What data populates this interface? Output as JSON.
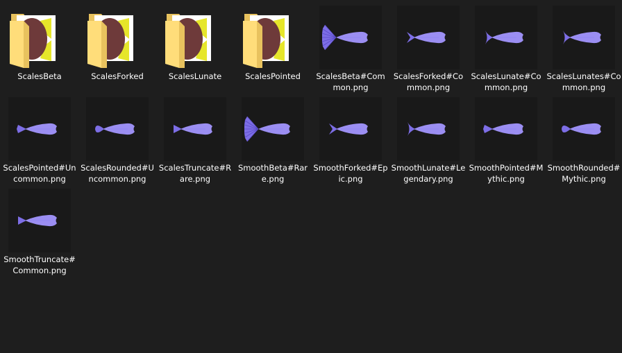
{
  "items": [
    {
      "name": "ScalesBeta",
      "kind": "folder",
      "icon": "folder-icon",
      "preview": "ScalesBeta"
    },
    {
      "name": "ScalesForked",
      "kind": "folder",
      "icon": "folder-icon",
      "preview": "ScalesForked"
    },
    {
      "name": "ScalesLunate",
      "kind": "folder",
      "icon": "folder-icon",
      "preview": "ScalesLunate"
    },
    {
      "name": "ScalesPointed",
      "kind": "folder",
      "icon": "folder-icon",
      "preview": "ScalesPointed"
    },
    {
      "name": "ScalesBeta#Common.png",
      "kind": "image",
      "icon": "fish-thumbnail",
      "tail": "beta"
    },
    {
      "name": "ScalesForked#Common.png",
      "kind": "image",
      "icon": "fish-thumbnail",
      "tail": "forked"
    },
    {
      "name": "ScalesLunate#Common.png",
      "kind": "image",
      "icon": "fish-thumbnail",
      "tail": "lunate"
    },
    {
      "name": "ScalesLunates#Common.png",
      "kind": "image",
      "icon": "fish-thumbnail",
      "tail": "lunate"
    },
    {
      "name": "ScalesPointed#Uncommon.png",
      "kind": "image",
      "icon": "fish-thumbnail",
      "tail": "pointed"
    },
    {
      "name": "ScalesRounded#Uncommon.png",
      "kind": "image",
      "icon": "fish-thumbnail",
      "tail": "rounded"
    },
    {
      "name": "ScalesTruncate#Rare.png",
      "kind": "image",
      "icon": "fish-thumbnail",
      "tail": "truncate"
    },
    {
      "name": "SmoothBeta#Rare.png",
      "kind": "image",
      "icon": "fish-thumbnail",
      "tail": "beta"
    },
    {
      "name": "SmoothForked#Epic.png",
      "kind": "image",
      "icon": "fish-thumbnail",
      "tail": "forked"
    },
    {
      "name": "SmoothLunate#Legendary.png",
      "kind": "image",
      "icon": "fish-thumbnail",
      "tail": "lunate"
    },
    {
      "name": "SmoothPointed#Mythic.png",
      "kind": "image",
      "icon": "fish-thumbnail",
      "tail": "pointed"
    },
    {
      "name": "SmoothRounded#Mythic.png",
      "kind": "image",
      "icon": "fish-thumbnail",
      "tail": "rounded"
    },
    {
      "name": "SmoothTruncate#Common.png",
      "kind": "image",
      "icon": "fish-thumbnail",
      "tail": "truncate"
    }
  ],
  "colors": {
    "background": "#1e1e1e",
    "thumbnail_bg": "#191919",
    "folder_back": "#e8c25e",
    "folder_front": "#ffdd7a",
    "folder_preview_disc": "#6e3a3a",
    "preview_accent": "#e6e62a",
    "fish_body": "#9b8ef2",
    "fish_tail": "#7d6ee6"
  }
}
